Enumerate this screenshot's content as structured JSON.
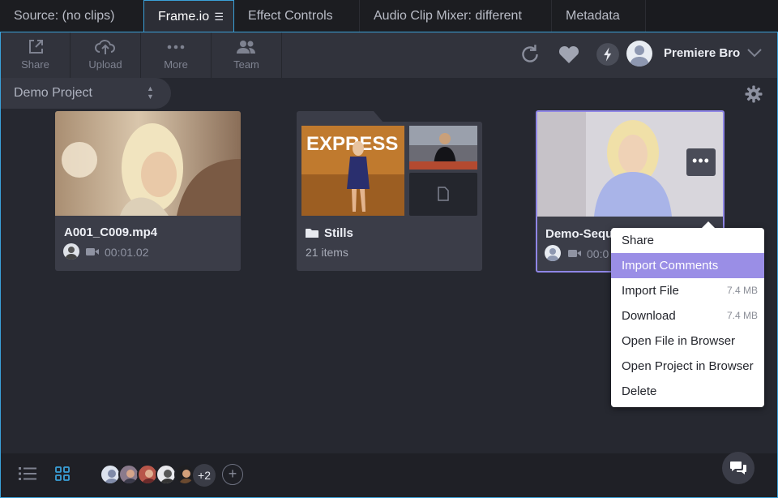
{
  "tabs": [
    {
      "label": "Source: (no clips)"
    },
    {
      "label": "Frame.io",
      "active": true
    },
    {
      "label": "Effect Controls"
    },
    {
      "label": "Audio Clip Mixer: different"
    },
    {
      "label": "Metadata"
    }
  ],
  "toolbar": {
    "share": "Share",
    "upload": "Upload",
    "more": "More",
    "team": "Team",
    "user_name": "Premiere Bro"
  },
  "project": {
    "name": "Demo Project"
  },
  "assets": [
    {
      "title": "A001_C009.mp4",
      "duration": "00:01.02"
    },
    {
      "title": "Stills",
      "count": "21 items",
      "express_text": "EXPRESS"
    },
    {
      "title": "Demo-Sequ",
      "duration": "00:0"
    }
  ],
  "context_menu": {
    "items": [
      {
        "label": "Share",
        "size": ""
      },
      {
        "label": "Import Comments",
        "size": "",
        "highlighted": true
      },
      {
        "label": "Import File",
        "size": "7.4 MB"
      },
      {
        "label": "Download",
        "size": "7.4 MB"
      },
      {
        "label": "Open File in Browser",
        "size": ""
      },
      {
        "label": "Open Project in Browser",
        "size": ""
      },
      {
        "label": "Delete",
        "size": ""
      }
    ]
  },
  "footer": {
    "extra_members": "+2"
  },
  "colors": {
    "accent_border": "#3aa0d8",
    "highlight": "#9a8ee6",
    "selection_border": "#8f86e6"
  }
}
